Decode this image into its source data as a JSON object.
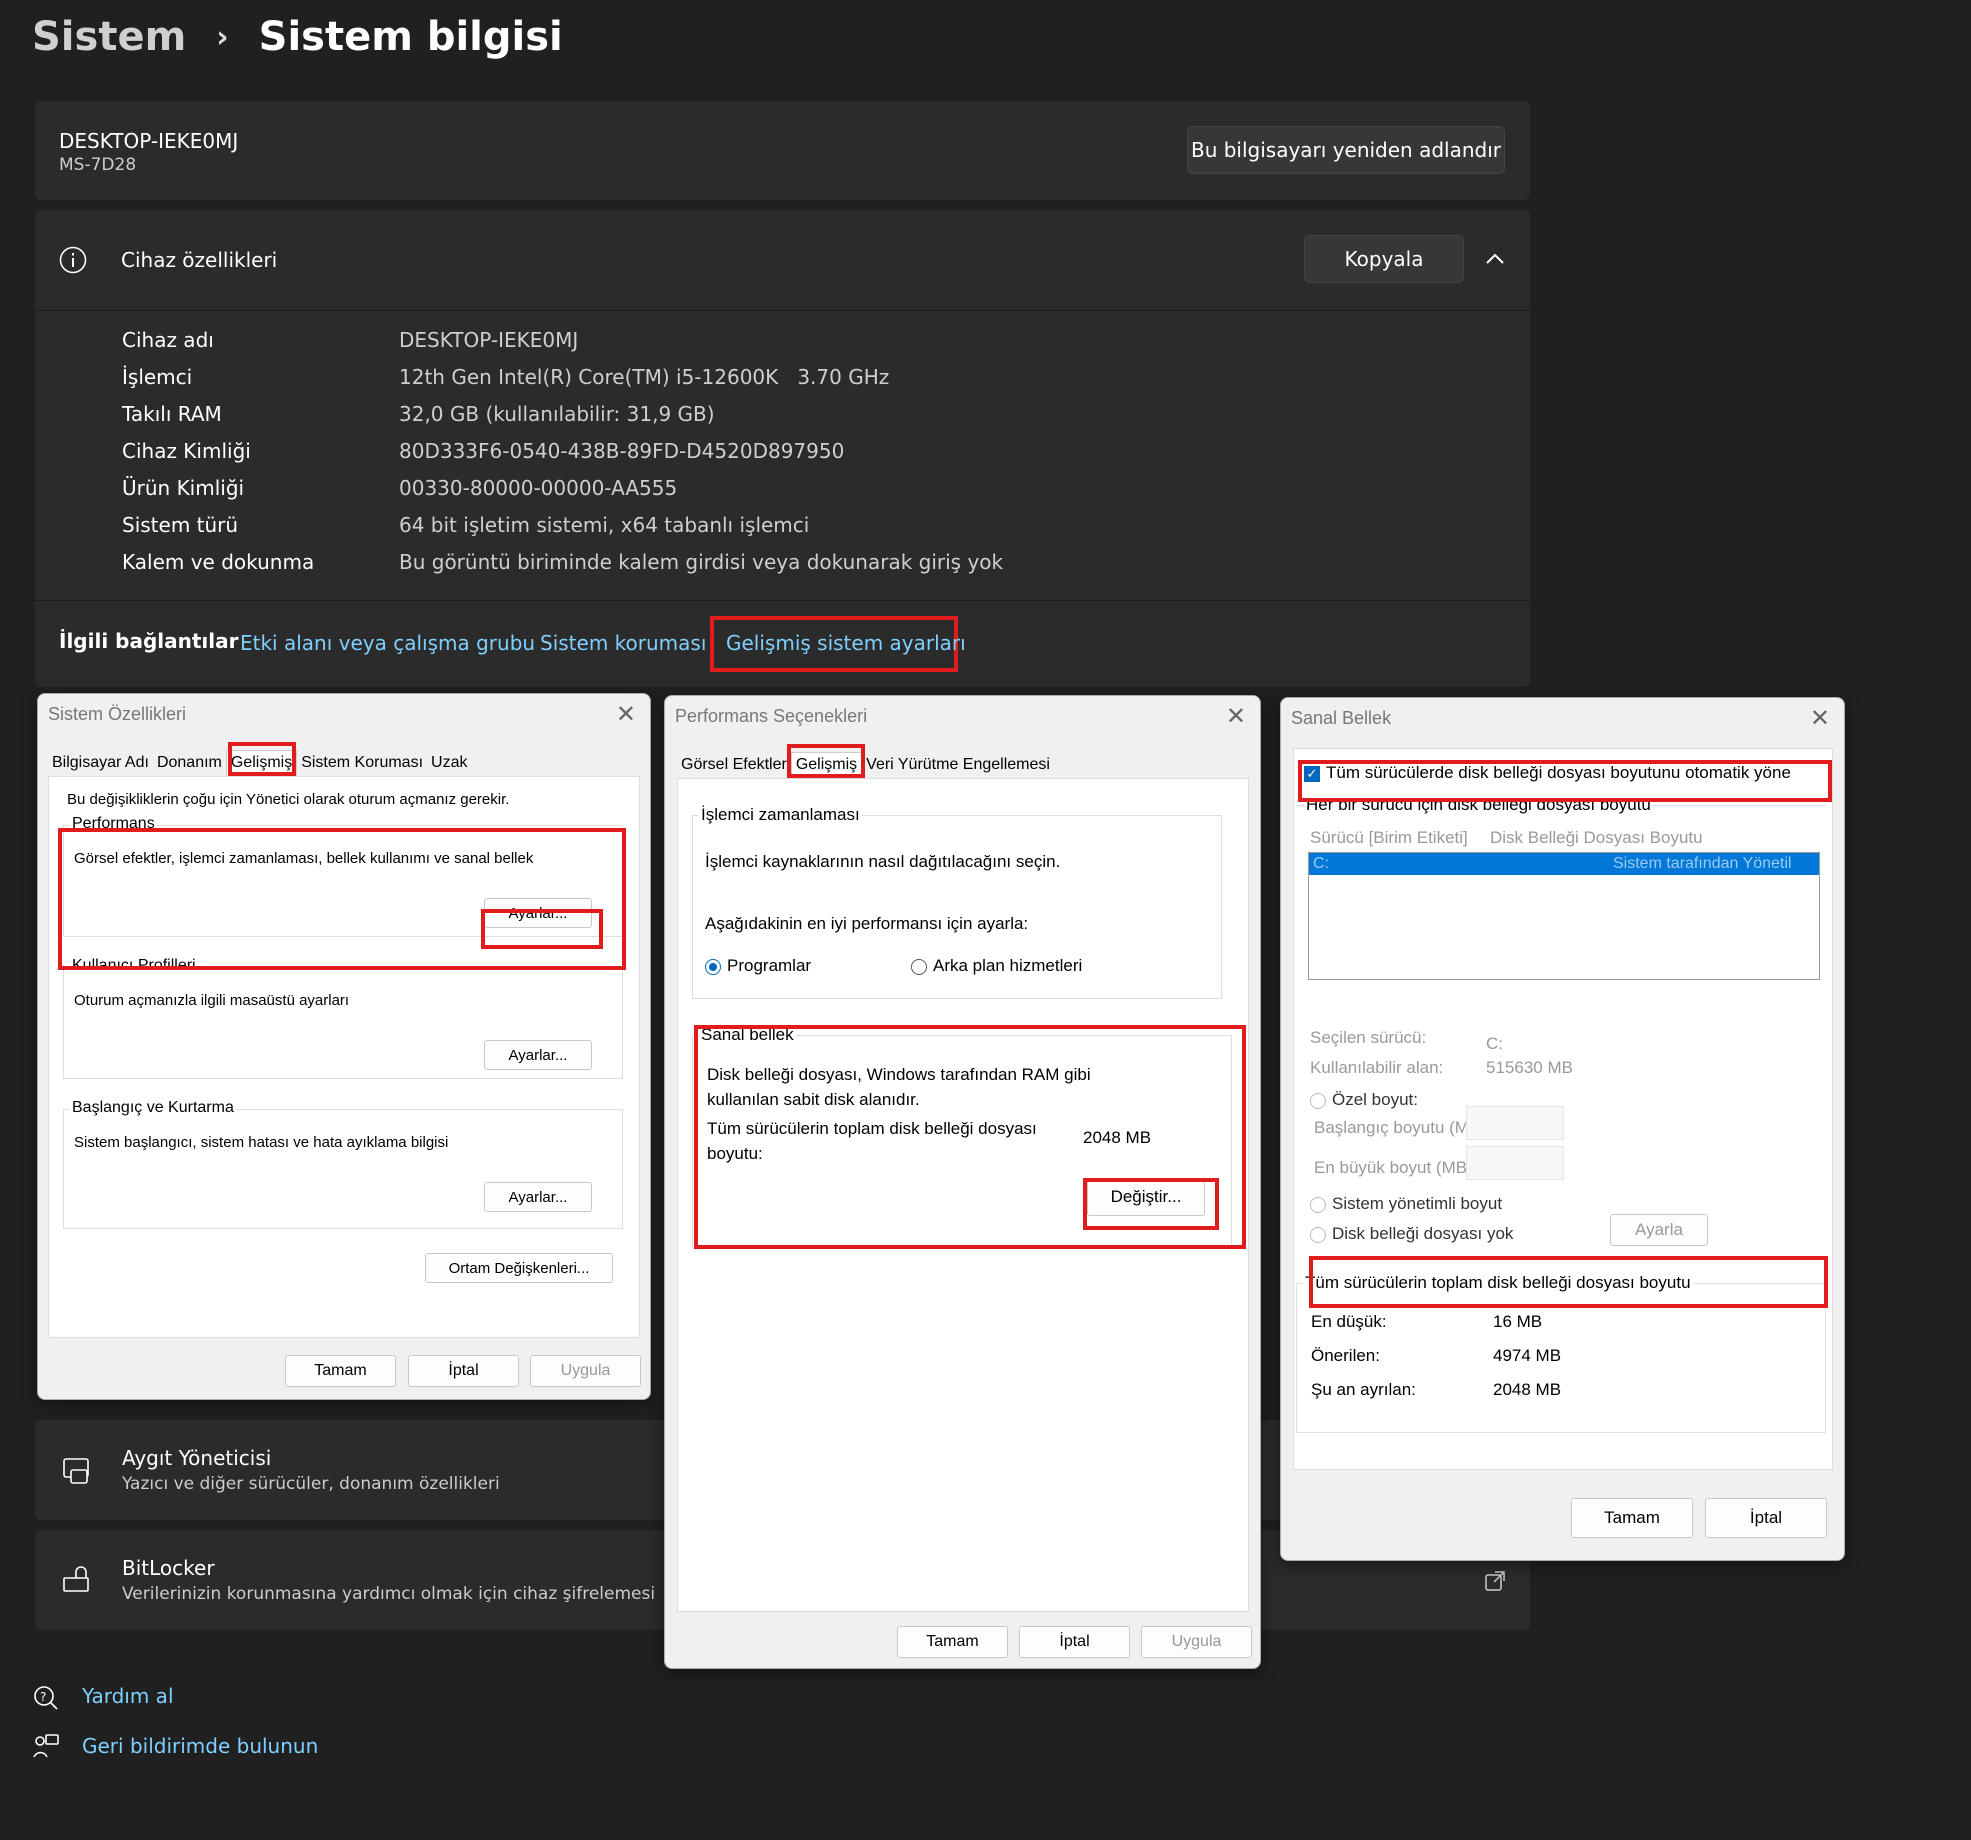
{
  "breadcrumb": {
    "parent": "Sistem",
    "separator": "›",
    "current": "Sistem bilgisi"
  },
  "computer": {
    "name": "DESKTOP-IEKE0MJ",
    "model": "MS-7D28",
    "rename_button": "Bu bilgisayarı yeniden adlandır"
  },
  "device_specs": {
    "title": "Cihaz özellikleri",
    "copy_button": "Kopyala",
    "rows": [
      {
        "label": "Cihaz adı",
        "value": "DESKTOP-IEKE0MJ"
      },
      {
        "label": "İşlemci",
        "value": "12th Gen Intel(R) Core(TM) i5-12600K   3.70 GHz"
      },
      {
        "label": "Takılı RAM",
        "value": "32,0 GB (kullanılabilir: 31,9 GB)"
      },
      {
        "label": "Cihaz Kimliği",
        "value": "80D333F6-0540-438B-89FD-D4520D897950"
      },
      {
        "label": "Ürün Kimliği",
        "value": "00330-80000-00000-AA555"
      },
      {
        "label": "Sistem türü",
        "value": "64 bit işletim sistemi, x64 tabanlı işlemci"
      },
      {
        "label": "Kalem ve dokunma",
        "value": "Bu görüntü biriminde kalem girdisi veya dokunarak giriş yok"
      }
    ]
  },
  "related": {
    "label": "İlgili bağlantılar",
    "links": [
      "Etki alanı veya çalışma grubu",
      "Sistem koruması",
      "Gelişmiş sistem ayarları"
    ]
  },
  "bottom_cards": [
    {
      "title": "Aygıt Yöneticisi",
      "desc": "Yazıcı ve diğer sürücüler, donanım özellikleri"
    },
    {
      "title": "BitLocker",
      "desc": "Verilerinizin korunmasına yardımcı olmak için cihaz şifrelemesi"
    }
  ],
  "footer_links": [
    "Yardım al",
    "Geri bildirimde bulunun"
  ],
  "dlg1": {
    "title": "Sistem Özellikleri",
    "tabs": [
      "Bilgisayar Adı",
      "Donanım",
      "Gelişmiş",
      "Sistem Koruması",
      "Uzak"
    ],
    "admin_note": "Bu değişikliklerin çoğu için Yönetici olarak oturum açmanız gerekir.",
    "perf_label": "Performans",
    "perf_desc": "Görsel efektler, işlemci zamanlaması, bellek kullanımı ve sanal bellek",
    "profiles_label": "Kullanıcı Profilleri",
    "profiles_desc": "Oturum açmanızla ilgili masaüstü ayarları",
    "startup_label": "Başlangıç ve Kurtarma",
    "startup_desc": "Sistem başlangıcı, sistem hatası ve hata ayıklama bilgisi",
    "settings_button": "Ayarlar...",
    "env_button": "Ortam Değişkenleri...",
    "ok": "Tamam",
    "cancel": "İptal",
    "apply": "Uygula"
  },
  "dlg2": {
    "title": "Performans Seçenekleri",
    "tabs": [
      "Görsel Efektler",
      "Gelişmiş",
      "Veri Yürütme Engellemesi"
    ],
    "cpu_label": "İşlemci zamanlaması",
    "cpu_desc": "İşlemci kaynaklarının nasıl dağıtılacağını seçin.",
    "adjust_label": "Aşağıdakinin en iyi performansı için ayarla:",
    "opt_programs": "Programlar",
    "opt_background": "Arka plan hizmetleri",
    "vm_label": "Sanal bellek",
    "vm_desc": "Disk belleği dosyası, Windows tarafından RAM gibi kullanılan sabit disk alanıdır.",
    "vm_total_label": "Tüm sürücülerin toplam disk belleği dosyası boyutu:",
    "vm_total_value": "2048 MB",
    "change_button": "Değiştir...",
    "ok": "Tamam",
    "cancel": "İptal",
    "apply": "Uygula"
  },
  "dlg3": {
    "title": "Sanal Bellek",
    "auto_manage": "Tüm sürücülerde disk belleği dosyası boyutunu otomatik yöne",
    "per_drive_label": "Her bir sürücü için disk belleği dosyası boyutu",
    "col_drive": "Sürücü  [Birim Etiketi]",
    "col_size": "Disk Belleği Dosyası Boyutu",
    "row_drive": "C:",
    "row_size": "Sistem tarafından Yönetil",
    "selected_drive_label": "Seçilen sürücü:",
    "selected_drive_value": "C:",
    "free_space_label": "Kullanılabilir alan:",
    "free_space_value": "515630 MB",
    "custom_size": "Özel boyut:",
    "initial_size": "Başlangıç boyutu (MB):",
    "max_size": "En büyük boyut (MB):",
    "system_managed": "Sistem yönetimli boyut",
    "no_paging": "Disk belleği dosyası yok",
    "set_button": "Ayarla",
    "total_label": "Tüm sürücülerin toplam disk belleği dosyası boyutu",
    "min_label": "En düşük:",
    "min_value": "16 MB",
    "rec_label": "Önerilen:",
    "rec_value": "4974 MB",
    "cur_label": "Şu an ayrılan:",
    "cur_value": "2048 MB",
    "ok": "Tamam",
    "cancel": "İptal"
  },
  "colors": {
    "background": "#202020",
    "card": "#2b2b2b",
    "link": "#7fd0ff",
    "highlight": "#e01c1c",
    "selection": "#0078d7"
  }
}
